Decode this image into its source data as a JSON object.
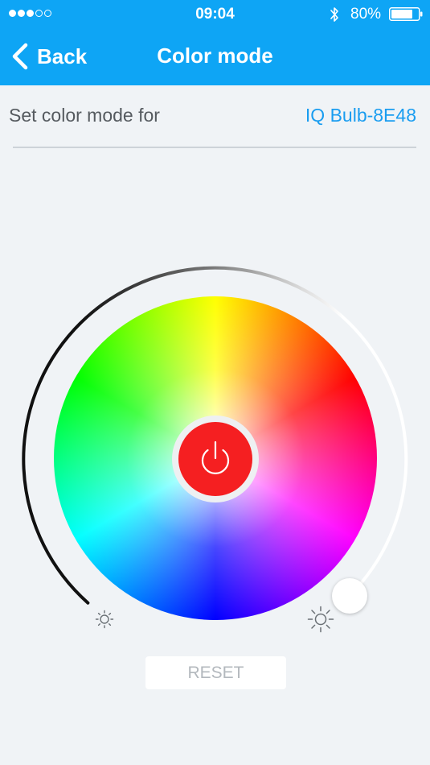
{
  "status_bar": {
    "signal_dots_filled": 3,
    "signal_dots_total": 5,
    "time": "09:04",
    "bluetooth_icon": "bluetooth-icon",
    "battery_percent": "80%",
    "battery_level": 0.8
  },
  "nav": {
    "back_label": "Back",
    "title": "Color mode"
  },
  "setting": {
    "label": "Set color mode for",
    "device_name": "IQ Bulb-8E48"
  },
  "controls": {
    "color_wheel": "color-wheel",
    "power_button_color": "#f51f21",
    "brightness_level": 1.0,
    "brightness_low_icon": "sun-low-icon",
    "brightness_high_icon": "sun-high-icon"
  },
  "reset_label": "RESET",
  "colors": {
    "accent": "#0ea5f5",
    "link": "#1a9df0",
    "background": "#f0f3f6"
  }
}
